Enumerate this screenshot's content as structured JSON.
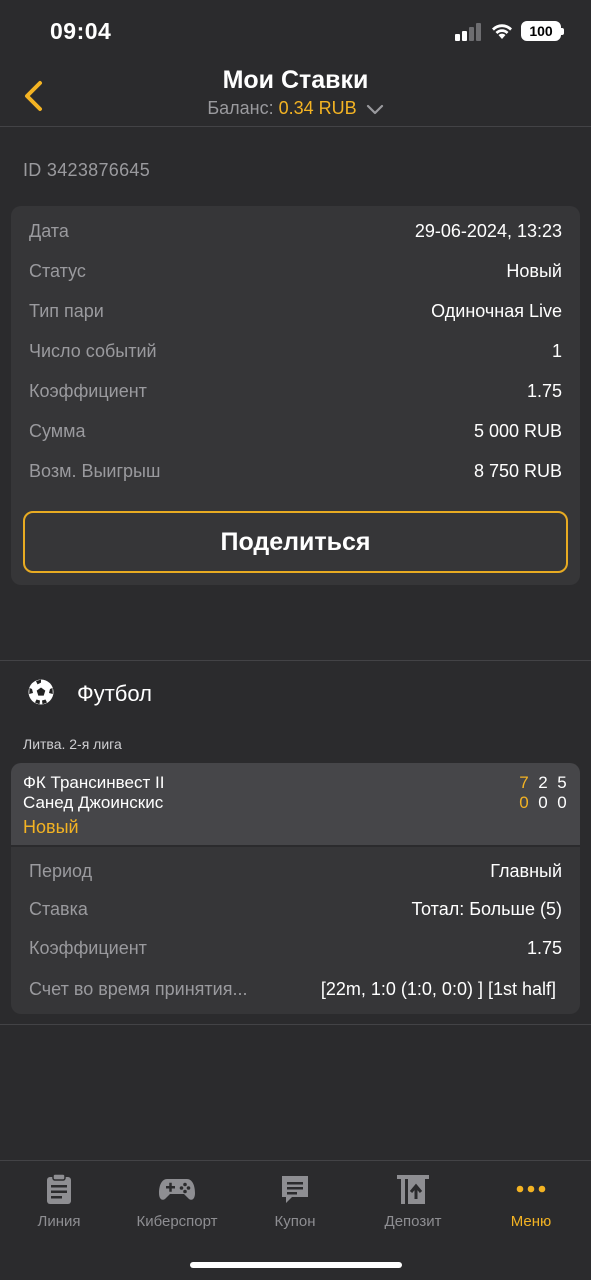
{
  "status_bar": {
    "time": "09:04",
    "battery": "100"
  },
  "header": {
    "title": "Мои Ставки",
    "balance_label": "Баланс:",
    "balance_value": "0.34 RUB"
  },
  "bet": {
    "id": "ID 3423876645",
    "rows": [
      {
        "label": "Дата",
        "value": "29-06-2024, 13:23"
      },
      {
        "label": "Статус",
        "value": "Новый"
      },
      {
        "label": "Тип пари",
        "value": "Одиночная Live"
      },
      {
        "label": "Число событий",
        "value": "1"
      },
      {
        "label": "Коэффициент",
        "value": "1.75"
      },
      {
        "label": "Сумма",
        "value": "5 000 RUB"
      },
      {
        "label": "Возм. Выигрыш",
        "value": "8 750 RUB"
      }
    ],
    "share_label": "Поделиться"
  },
  "sport": {
    "name": "Футбол",
    "icon": "soccer-ball-icon"
  },
  "event": {
    "league": "Литва. 2-я лига",
    "team1": "ФК Трансинвест II",
    "team2": "Санед Джоинскис",
    "status": "Новый",
    "scores1": [
      "7",
      "2",
      "5"
    ],
    "scores2": [
      "0",
      "0",
      "0"
    ],
    "rows": [
      {
        "label": "Период",
        "value": "Главный"
      },
      {
        "label": "Ставка",
        "value": "Тотал: Больше (5)"
      },
      {
        "label": "Коэффициент",
        "value": "1.75"
      },
      {
        "label": "Счет во время принятия...",
        "value": "[22m, 1:0 (1:0, 0:0) ] [1st half]"
      }
    ]
  },
  "tabs": [
    {
      "label": "Линия",
      "icon": "clipboard-icon",
      "active": false
    },
    {
      "label": "Киберспорт",
      "icon": "gamepad-icon",
      "active": false
    },
    {
      "label": "Купон",
      "icon": "coupon-icon",
      "active": false
    },
    {
      "label": "Депозит",
      "icon": "deposit-icon",
      "active": false
    },
    {
      "label": "Меню",
      "icon": "more-dots-icon",
      "active": true
    }
  ],
  "colors": {
    "accent": "#f3b323",
    "background": "#2b2b2d",
    "card": "#363638",
    "muted": "#9a9a9e"
  }
}
